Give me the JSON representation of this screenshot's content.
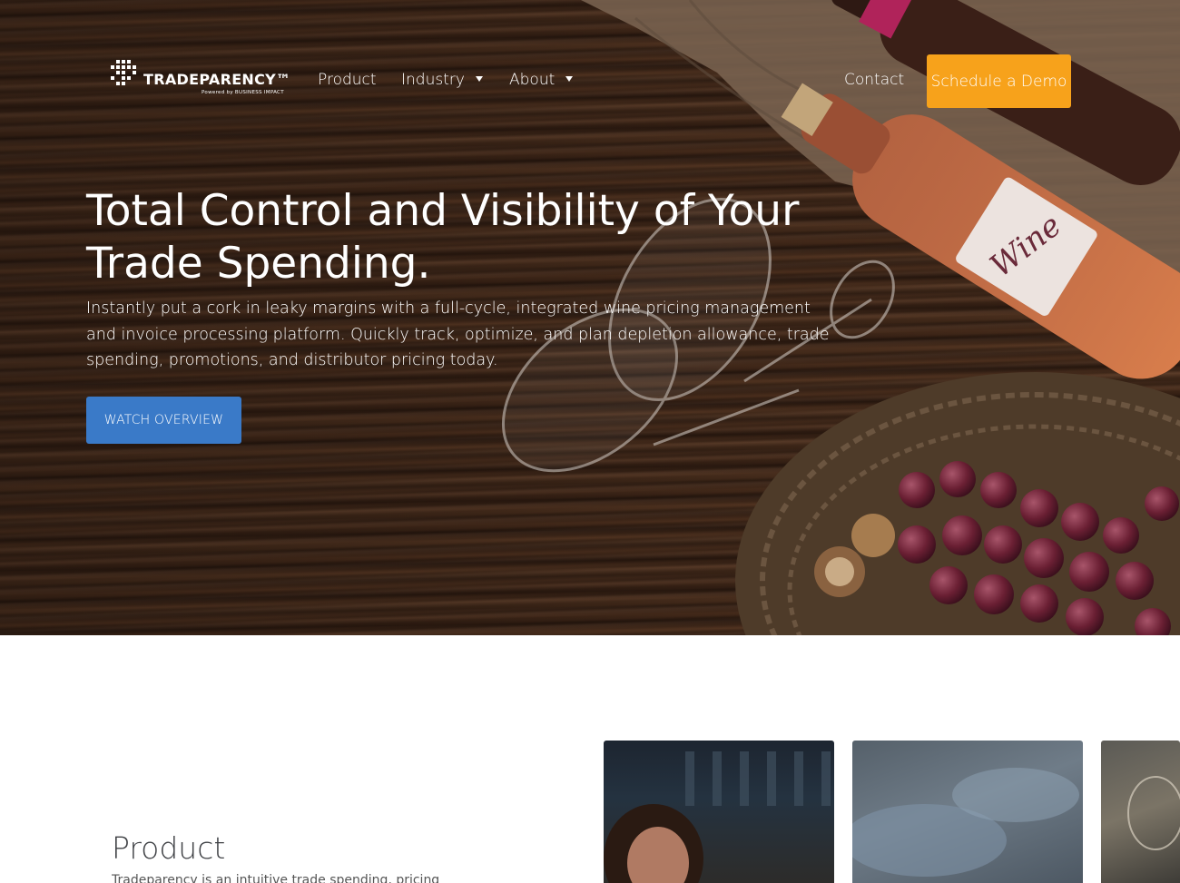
{
  "nav": {
    "logo_text": "TRADEPARENCY™",
    "logo_sub": "Powered by BUSINESS IMPACT",
    "links": [
      {
        "label": "Product"
      },
      {
        "label": "Industry"
      },
      {
        "label": "About"
      },
      {
        "label": "Contact"
      }
    ],
    "cta_label": "Schedule a Demo"
  },
  "hero": {
    "title": "Total Control and Visibility of Your Trade Spending.",
    "subtitle": "Instantly put a cork in leaky margins with a full-cycle, integrated wine pricing management and invoice processing platform. Quickly track, optimize, and plan depletion allowance, trade spending, promotions, and distributor pricing today.",
    "button_label": "WATCH OVERVIEW",
    "wine_label": "Wine"
  },
  "product": {
    "heading": "Product",
    "text": "Tradeparency is an intuitive trade spending, pricing"
  },
  "colors": {
    "accent_orange": "#f7a21b",
    "accent_blue": "#3a7ac8",
    "wood_dark": "#3d2718"
  }
}
